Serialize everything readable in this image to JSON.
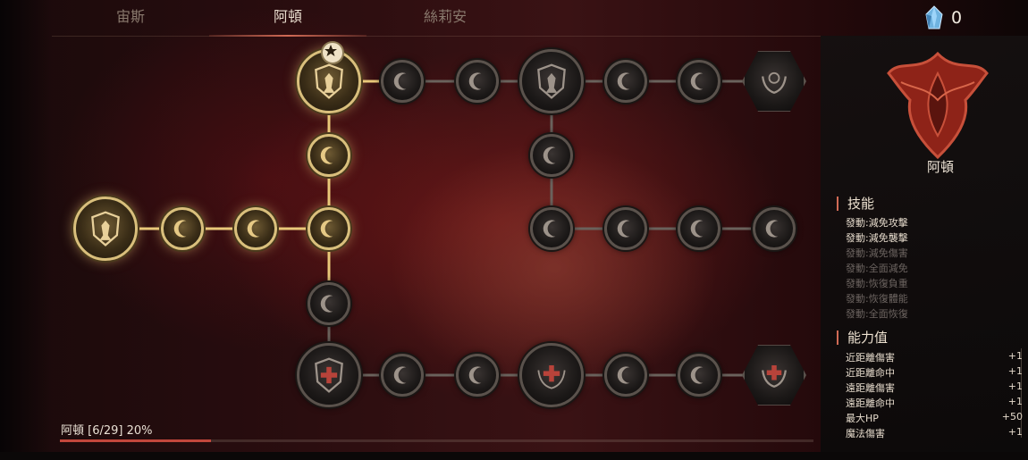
{
  "tabs": [
    {
      "label": "宙斯",
      "active": false
    },
    {
      "label": "阿頓",
      "active": true
    },
    {
      "label": "絲莉安",
      "active": false
    }
  ],
  "currency": {
    "icon": "crystal-icon",
    "value": "0"
  },
  "panel": {
    "name": "阿頓",
    "skills_title": "技能",
    "skills": [
      {
        "label": "發動:減免攻擊",
        "active": true
      },
      {
        "label": "發動:減免襲擊",
        "active": true
      },
      {
        "label": "發動:減免傷害",
        "active": false
      },
      {
        "label": "發動:全面減免",
        "active": false
      },
      {
        "label": "發動:恢復負重",
        "active": false
      },
      {
        "label": "發動:恢復體能",
        "active": false
      },
      {
        "label": "發動:全面恢復",
        "active": false
      }
    ],
    "stats_title": "能力值",
    "stats": [
      {
        "label": "近距離傷害",
        "value": "+1"
      },
      {
        "label": "近距離命中",
        "value": "+1"
      },
      {
        "label": "遠距離傷害",
        "value": "+1"
      },
      {
        "label": "遠距離命中",
        "value": "+1"
      },
      {
        "label": "最大HP",
        "value": "+50"
      },
      {
        "label": "魔法傷害",
        "value": "+1"
      }
    ]
  },
  "progress": {
    "label": "阿頓 [6/29] 20%",
    "fraction": 0.2
  },
  "colors": {
    "accent": "#c2473c",
    "gold": "#d9bf7c",
    "dim": "#5a524c"
  },
  "tree": {
    "lit_nodes": 6,
    "total_nodes": 29,
    "icons": {
      "start": "shield-warrior-icon",
      "minor": "crescent-moon-icon",
      "major_shield": "shield-warrior-icon",
      "major_cross": "cross-shield-icon",
      "laurel": "laurel-icon"
    }
  }
}
